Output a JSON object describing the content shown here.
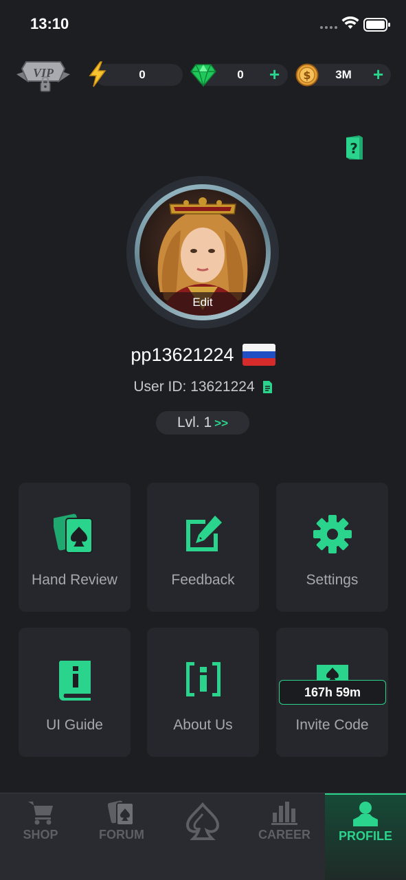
{
  "status_bar": {
    "time": "13:10"
  },
  "currency": {
    "vip_label": "VIP",
    "energy": "0",
    "gems": "0",
    "coins": "3M",
    "plus": "+"
  },
  "profile": {
    "edit_label": "Edit",
    "username": "pp13621224",
    "user_id_label": "User ID: 13621224",
    "level": "Lvl. 1",
    "level_arrow": ">>"
  },
  "menu": [
    {
      "label": "Hand Review",
      "icon": "cards-icon"
    },
    {
      "label": "Feedback",
      "icon": "edit-icon"
    },
    {
      "label": "Settings",
      "icon": "gear-icon"
    },
    {
      "label": "UI Guide",
      "icon": "guide-book-icon"
    },
    {
      "label": "About Us",
      "icon": "info-icon"
    },
    {
      "label": "Invite Code",
      "icon": "envelope-icon",
      "timer": "167h 59m"
    }
  ],
  "nav": [
    {
      "label": "SHOP",
      "icon": "cart-icon"
    },
    {
      "label": "FORUM",
      "icon": "forum-cards-icon"
    },
    {
      "label": "",
      "icon": "spade-logo-icon"
    },
    {
      "label": "CAREER",
      "icon": "bar-chart-icon"
    },
    {
      "label": "PROFILE",
      "icon": "person-icon",
      "active": true
    }
  ],
  "colors": {
    "accent": "#2bd48c",
    "background": "#1d1e22",
    "tile": "#26272c"
  }
}
